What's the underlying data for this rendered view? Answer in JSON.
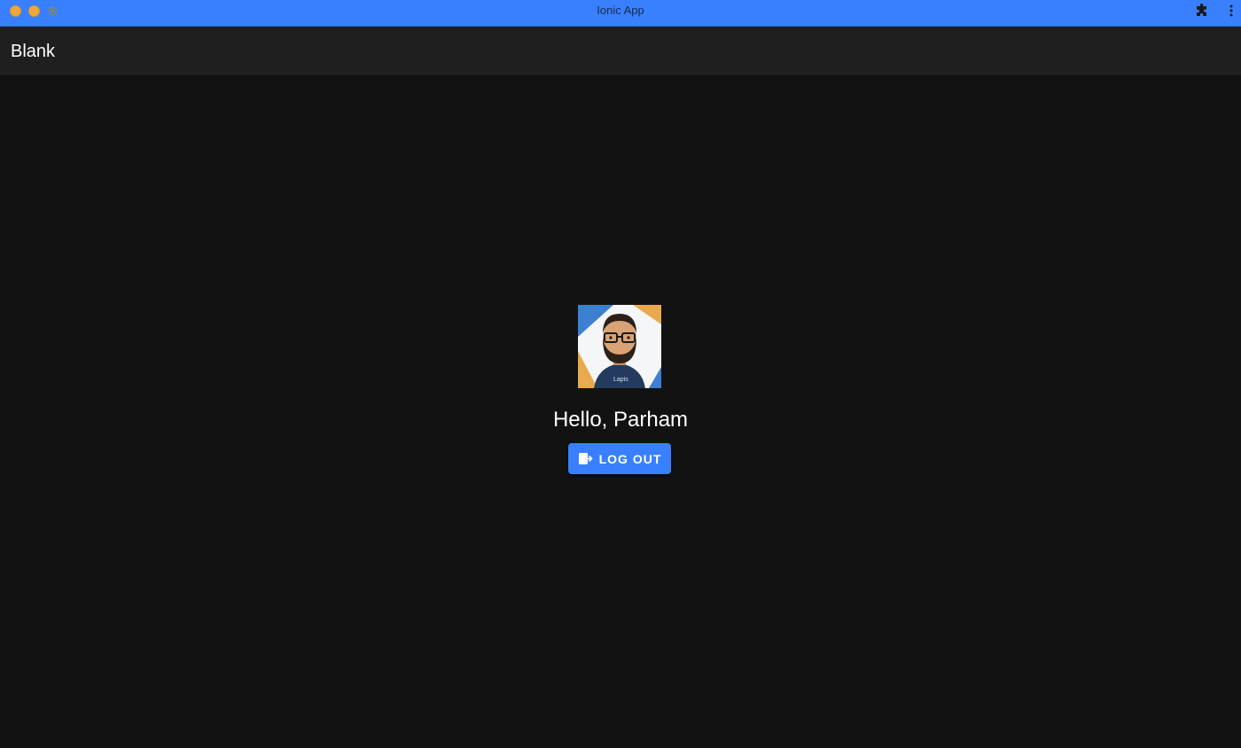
{
  "window": {
    "title": "Ionic App",
    "accent_color": "#3880ff",
    "icons": [
      "extensions-puzzle-icon",
      "more-vertical-icon"
    ]
  },
  "header": {
    "title": "Blank"
  },
  "main": {
    "avatar_icon": "user-avatar",
    "greeting": "Hello, Parham",
    "logout": {
      "label": "LOG OUT",
      "icon": "log-out-icon"
    }
  }
}
